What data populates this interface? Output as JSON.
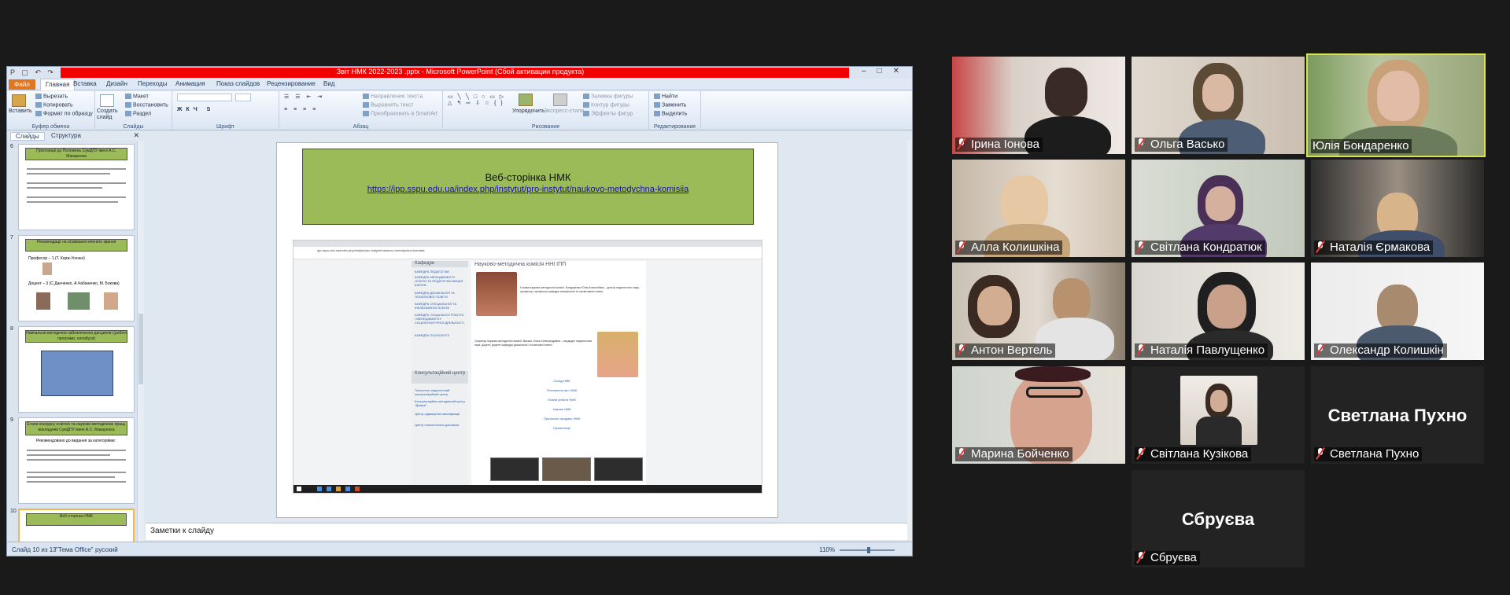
{
  "ppt": {
    "window_title": "Звіт НМК 2022-2023 .pptx  -  Microsoft PowerPoint (Сбой активации продукта)",
    "file_tab": "Файл",
    "tabs": [
      "Главная",
      "Вставка",
      "Дизайн",
      "Переходы",
      "Анимация",
      "Показ слайдов",
      "Рецензирование",
      "Вид"
    ],
    "ribbon": {
      "clipboard": {
        "paste": "Вставить",
        "cut": "Вырезать",
        "copy": "Копировать",
        "format_painter": "Формат по образцу",
        "label": "Буфер обмена"
      },
      "slides": {
        "create": "Создать слайд",
        "layout": "Макет",
        "reset": "Восстановить",
        "section": "Раздел",
        "label": "Слайды"
      },
      "font": {
        "label": "Шрифт"
      },
      "paragraph": {
        "direction": "Направление текста",
        "align": "Выровнять текст",
        "smartart": "Преобразовать в SmartArt",
        "label": "Абзац"
      },
      "drawing": {
        "arrange": "Упорядочить",
        "styles": "Экспресс-стили",
        "fill": "Заливка фигуры",
        "outline": "Контур фигуры",
        "effects": "Эффекты фигур",
        "label": "Рисование"
      },
      "editing": {
        "find": "Найти",
        "replace": "Заменить",
        "select": "Выделить",
        "label": "Редактирование"
      }
    },
    "panel": {
      "tab_slides": "Слайды",
      "tab_outline": "Структура"
    },
    "thumbs": [
      {
        "num": "6",
        "title": "Пропозиції до Положень СумДПУ імені А.С. Макаренка"
      },
      {
        "num": "7",
        "title": "Рекомендації на отримання вченого звання",
        "line1": "Професор – 1 (Т. Корж-Усенко)",
        "line2": "Доцент – 3 (С.Данченко, А.Чабаненко, М. Бокова)"
      },
      {
        "num": "8",
        "title": "Навчально-методичне забезпечення дисциплін (робочі програми, силабуси)"
      },
      {
        "num": "9",
        "title": "Етапи конкурсу освітніх та науково-методичних праць викладачів СумДПУ імені А.С. Макаренка",
        "line1": "Рекомендовано до видання за категоріями:"
      },
      {
        "num": "10",
        "title": "Веб-сторінка НМК"
      }
    ],
    "slide": {
      "title": "Веб-сторінка НМК",
      "link": "https://ipp.sspu.edu.ua/index.php/instytut/pro-instytut/naukovo-metodychna-komisiia",
      "embedded": {
        "url": "ipp.sspu.edu.ua/index.php/instytut/pro-instytut/naukovo-metodychna-komisiia",
        "sidebar_title": "Кафедри",
        "sidebar_links": [
          "КАФЕДРА ПЕДАГОГІКИ",
          "КАФЕДРА МЕНЕДЖМЕНТУ ОСВІТИ ТА ПЕДАГОГІКИ ВИЩОЇ ШКОЛИ",
          "КАФЕДРА ДОШКІЛЬНОЇ ТА ПОЧАТКОВОЇ ОСВІТИ",
          "КАФЕДРА СПЕЦІАЛЬНОЇ ТА ІНКЛЮЗИВНОЇ ОСВІТИ",
          "КАФЕДРА СОЦІАЛЬНОЇ РОБОТИ І МЕНЕДЖМЕНТУ СОЦІОКУЛЬТУРНОЇ ДІЯЛЬНОСТІ",
          "КАФЕДРА ПСИХОЛОГІЇ"
        ],
        "sidebar_title2": "Консультаційний центр",
        "sidebar_links2": [
          "Психолого-педагогічний консультаційний центр",
          "Консультаційно-методичний центр \"Довіра\"",
          "Центр підвищення кваліфікації",
          "Центр психологічної допомоги"
        ],
        "main_title": "Науково-методична комісія ННІ ІПП",
        "chair_text": "Голова науково-методичної комісії: Бондаренко Юлія Анатоліївна – доктор педагогічних наук, професор, професор кафедри спеціальної та інклюзивної освіти.",
        "secretary_text": "Секретар науково-методичної комісії: Васько Ольга Олександрівна – кандидат педагогічних наук, доцент, доцент кафедри дошкільної і початкової освіти.",
        "center_links": [
          "Склад НМК",
          "Положення про НМК",
          "Плани роботи НМК",
          "Накази НМК",
          "Протоколи засідань НМК",
          "Презентації"
        ]
      }
    },
    "notes_placeholder": "Заметки к слайду",
    "status": {
      "slide": "Слайд 10 из 13",
      "theme": "\"Тема Office\"",
      "lang": "русский",
      "zoom": "110%"
    }
  },
  "participants": [
    {
      "name": "Ірина Іонова",
      "muted": true,
      "video": true,
      "active": false
    },
    {
      "name": "Ольга Васько",
      "muted": true,
      "video": true,
      "active": false
    },
    {
      "name": "Юлія Бондаренко",
      "muted": false,
      "video": true,
      "active": true
    },
    {
      "name": "Алла Колишкіна",
      "muted": true,
      "video": true,
      "active": false
    },
    {
      "name": "Світлана Кондратюк",
      "muted": true,
      "video": true,
      "active": false
    },
    {
      "name": "Наталія Єрмакова",
      "muted": true,
      "video": true,
      "active": false
    },
    {
      "name": "Антон Вертель",
      "muted": true,
      "video": true,
      "active": false
    },
    {
      "name": "Наталія Павлущенко",
      "muted": true,
      "video": true,
      "active": false
    },
    {
      "name": "Олександр Колишкін",
      "muted": true,
      "video": true,
      "active": false
    },
    {
      "name": "Марина Бойченко",
      "muted": true,
      "video": true,
      "active": false
    },
    {
      "name": "Світлана Кузікова",
      "muted": true,
      "video": false,
      "active": false
    },
    {
      "name": "Светлана Пухно",
      "muted": true,
      "video": false,
      "active": false,
      "big_label": "Светлана Пухно"
    },
    {
      "name": "Сбруєва",
      "muted": true,
      "video": false,
      "active": false,
      "big_label": "Сбруєва"
    }
  ]
}
